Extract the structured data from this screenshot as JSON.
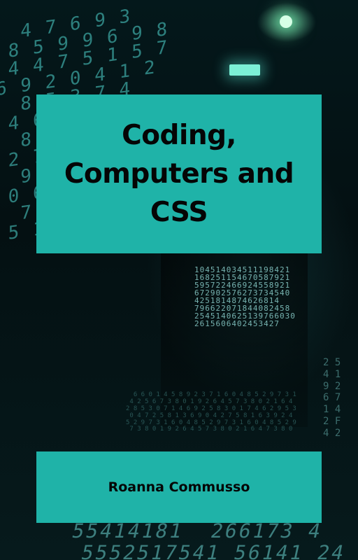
{
  "cover": {
    "title_line1": "Coding,",
    "title_line2": "Computers and",
    "title_line3": "CSS",
    "author": "Roanna Commusso"
  },
  "colors": {
    "panel": "#1fb3a8",
    "text": "#050505",
    "background": "#041012",
    "digits": "#4fd6d0"
  }
}
